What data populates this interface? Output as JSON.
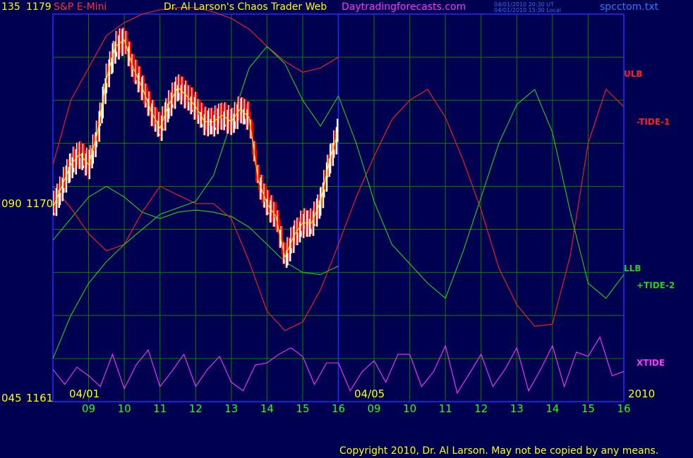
{
  "header": {
    "left_scale": "135",
    "left_price": "1179",
    "symbol": "S&P E-Mini",
    "title": "Dr. Al Larson's Chaos Trader Web",
    "site": "Daytradingforecasts.com",
    "time_ut": "04/01/2010 20:30 UT",
    "time_local": "04/01/2010 15:30 Local",
    "file": "spcctom.txt"
  },
  "y_labels": {
    "top": {
      "scale": "135",
      "price": "1179"
    },
    "mid": {
      "scale": "090",
      "price": "1170"
    },
    "bottom": {
      "scale": "045",
      "price": "1161"
    }
  },
  "date_labels": {
    "start": "04/01",
    "forecast": "04/05",
    "year": "2010"
  },
  "legend": {
    "ulb": "ULB",
    "tide1": "-TIDE-1",
    "llb": "LLB",
    "tide2": "+TIDE-2",
    "xtide": "XTIDE"
  },
  "copyright": "Copyright 2010, Dr. Al Larson. May not be copied by any means.",
  "colors": {
    "background": "#000050",
    "grid": "#008000",
    "frame": "#2030ff",
    "price_up": "#ffffff",
    "price_down": "#ff0000",
    "ma": "#ffff00",
    "ulb": "#ff2020",
    "llb": "#20d020",
    "tide1": "#ff2020",
    "tide2": "#20d020",
    "xtide": "#ff33ff",
    "blue_line": "#1010ff",
    "axis_text": "#ffff00",
    "hour_text": "#20ff20",
    "site_text": "#ff33ff"
  },
  "chart_data": {
    "type": "line",
    "title": "S&P E-Mini",
    "x_ticks": [
      "09",
      "10",
      "11",
      "12",
      "13",
      "14",
      "15",
      "16",
      "09",
      "10",
      "11",
      "12",
      "13",
      "14",
      "15",
      "16"
    ],
    "y_ticks_scale": [
      "135",
      "090",
      "045"
    ],
    "y_ticks_price": [
      1179,
      1170,
      1161
    ],
    "ylim": [
      1161,
      1179
    ],
    "grid": true,
    "series": [
      {
        "name": "ULB",
        "x": [
          8.0,
          8.5,
          9,
          9.5,
          10,
          10.5,
          11,
          11.5,
          12,
          12.5,
          13,
          13.5,
          14,
          14.5,
          15,
          15.5,
          16
        ],
        "y": [
          1172,
          1175,
          1176.5,
          1178,
          1178.6,
          1179,
          1179.2,
          1179.3,
          1179.3,
          1179.1,
          1178.8,
          1178.3,
          1177.5,
          1176.8,
          1176.3,
          1176.5,
          1177
        ]
      },
      {
        "name": "LLB",
        "x": [
          8.0,
          8.5,
          9,
          9.5,
          10,
          10.5,
          11,
          11.5,
          12,
          12.5,
          13,
          13.5,
          14,
          14.5,
          15,
          15.5,
          16
        ],
        "y": [
          1168.5,
          1169.5,
          1170.5,
          1171,
          1170.5,
          1169.8,
          1169.5,
          1169.8,
          1169.9,
          1169.8,
          1169.6,
          1169.1,
          1168.3,
          1167.5,
          1167,
          1166.9,
          1167.3
        ]
      },
      {
        "name": "-TIDE-1",
        "x": [
          8.0,
          8.5,
          9,
          9.5,
          10,
          10.5,
          11,
          11.5,
          12,
          12.5,
          13,
          13.5,
          14,
          14.5,
          15,
          15.5,
          16,
          16.5,
          17,
          17.5,
          18,
          18.5,
          19,
          19.5,
          20,
          20.5,
          21,
          21.5,
          22,
          22.5,
          23,
          23.5,
          24
        ],
        "y": [
          1171,
          1170,
          1168.8,
          1168,
          1168.3,
          1169.8,
          1171,
          1170.6,
          1170.2,
          1170.2,
          1169.5,
          1167.5,
          1165.2,
          1164.3,
          1164.7,
          1166.2,
          1168.3,
          1170.5,
          1172.4,
          1174.1,
          1175,
          1175.5,
          1174.2,
          1172.2,
          1169.9,
          1167.2,
          1165.5,
          1164.5,
          1164.6,
          1167.8,
          1173,
          1175.5,
          1174.7
        ]
      },
      {
        "name": "+TIDE-2",
        "x": [
          8.0,
          8.5,
          9,
          9.5,
          10,
          10.5,
          11,
          11.5,
          12,
          12.5,
          13,
          13.5,
          14,
          14.5,
          15,
          15.5,
          16,
          16.5,
          17,
          17.5,
          18,
          18.5,
          19,
          19.5,
          20,
          20.5,
          21,
          21.5,
          22,
          22.5,
          23,
          23.5,
          24
        ],
        "y": [
          1163,
          1165,
          1166.5,
          1167.5,
          1168.3,
          1169,
          1169.7,
          1170,
          1170.3,
          1171.5,
          1174,
          1176.5,
          1177.5,
          1176.7,
          1175,
          1173.8,
          1175.2,
          1173,
          1170.3,
          1168.3,
          1167.4,
          1166.5,
          1165.8,
          1168,
          1170.5,
          1173,
          1174.8,
          1175.5,
          1173.5,
          1169.8,
          1166.5,
          1165.8,
          1166.9
        ]
      },
      {
        "name": "XTIDE",
        "x": [
          8.0,
          8.33,
          8.67,
          9,
          9.33,
          9.67,
          10,
          10.33,
          10.67,
          11,
          11.33,
          11.67,
          12,
          12.33,
          12.67,
          13,
          13.33,
          13.67,
          14,
          14.33,
          14.67,
          15,
          15.33,
          15.67,
          16,
          16.33,
          16.67,
          17,
          17.33,
          17.67,
          18,
          18.33,
          18.67,
          19,
          19.33,
          19.67,
          20,
          20.33,
          20.67,
          21,
          21.33,
          21.67,
          22,
          22.33,
          22.67,
          23,
          23.33,
          23.67,
          24
        ],
        "y": [
          1162.5,
          1161.8,
          1162.6,
          1162.2,
          1161.7,
          1163.2,
          1161.6,
          1162.7,
          1163.4,
          1161.7,
          1162.4,
          1163.2,
          1161.7,
          1162.5,
          1163.1,
          1161.9,
          1161.5,
          1162.7,
          1162.8,
          1163.2,
          1163.5,
          1163.1,
          1161.8,
          1162.8,
          1162.8,
          1161.5,
          1162.4,
          1162.9,
          1161.9,
          1163.2,
          1163.2,
          1161.7,
          1162.4,
          1163.6,
          1161.4,
          1162.3,
          1163.2,
          1161.7,
          1162.5,
          1163.5,
          1161.5,
          1162.5,
          1163.6,
          1161.7,
          1163.3,
          1163.1,
          1164,
          1162.2,
          1162.4
        ]
      },
      {
        "name": "Price",
        "x": [
          8.0,
          8.25,
          8.5,
          8.75,
          9,
          9.25,
          9.5,
          9.75,
          10,
          10.25,
          10.5,
          10.75,
          11,
          11.25,
          11.5,
          11.75,
          12,
          12.25,
          12.5,
          12.75,
          13,
          13.25,
          13.5,
          13.75,
          14,
          14.25,
          14.5,
          14.75,
          15,
          15.25,
          15.5,
          15.75,
          16
        ],
        "y": [
          1170,
          1171,
          1172,
          1172.5,
          1172,
          1173.5,
          1176,
          1177.5,
          1177.8,
          1176.5,
          1175.6,
          1174.5,
          1173.7,
          1174.8,
          1175.6,
          1175.2,
          1174.7,
          1174,
          1174,
          1174.3,
          1174,
          1174.6,
          1174.2,
          1171.3,
          1170.2,
          1169.6,
          1167.7,
          1168.7,
          1169.3,
          1169.3,
          1170.3,
          1172.2,
          1173.6
        ]
      }
    ]
  }
}
